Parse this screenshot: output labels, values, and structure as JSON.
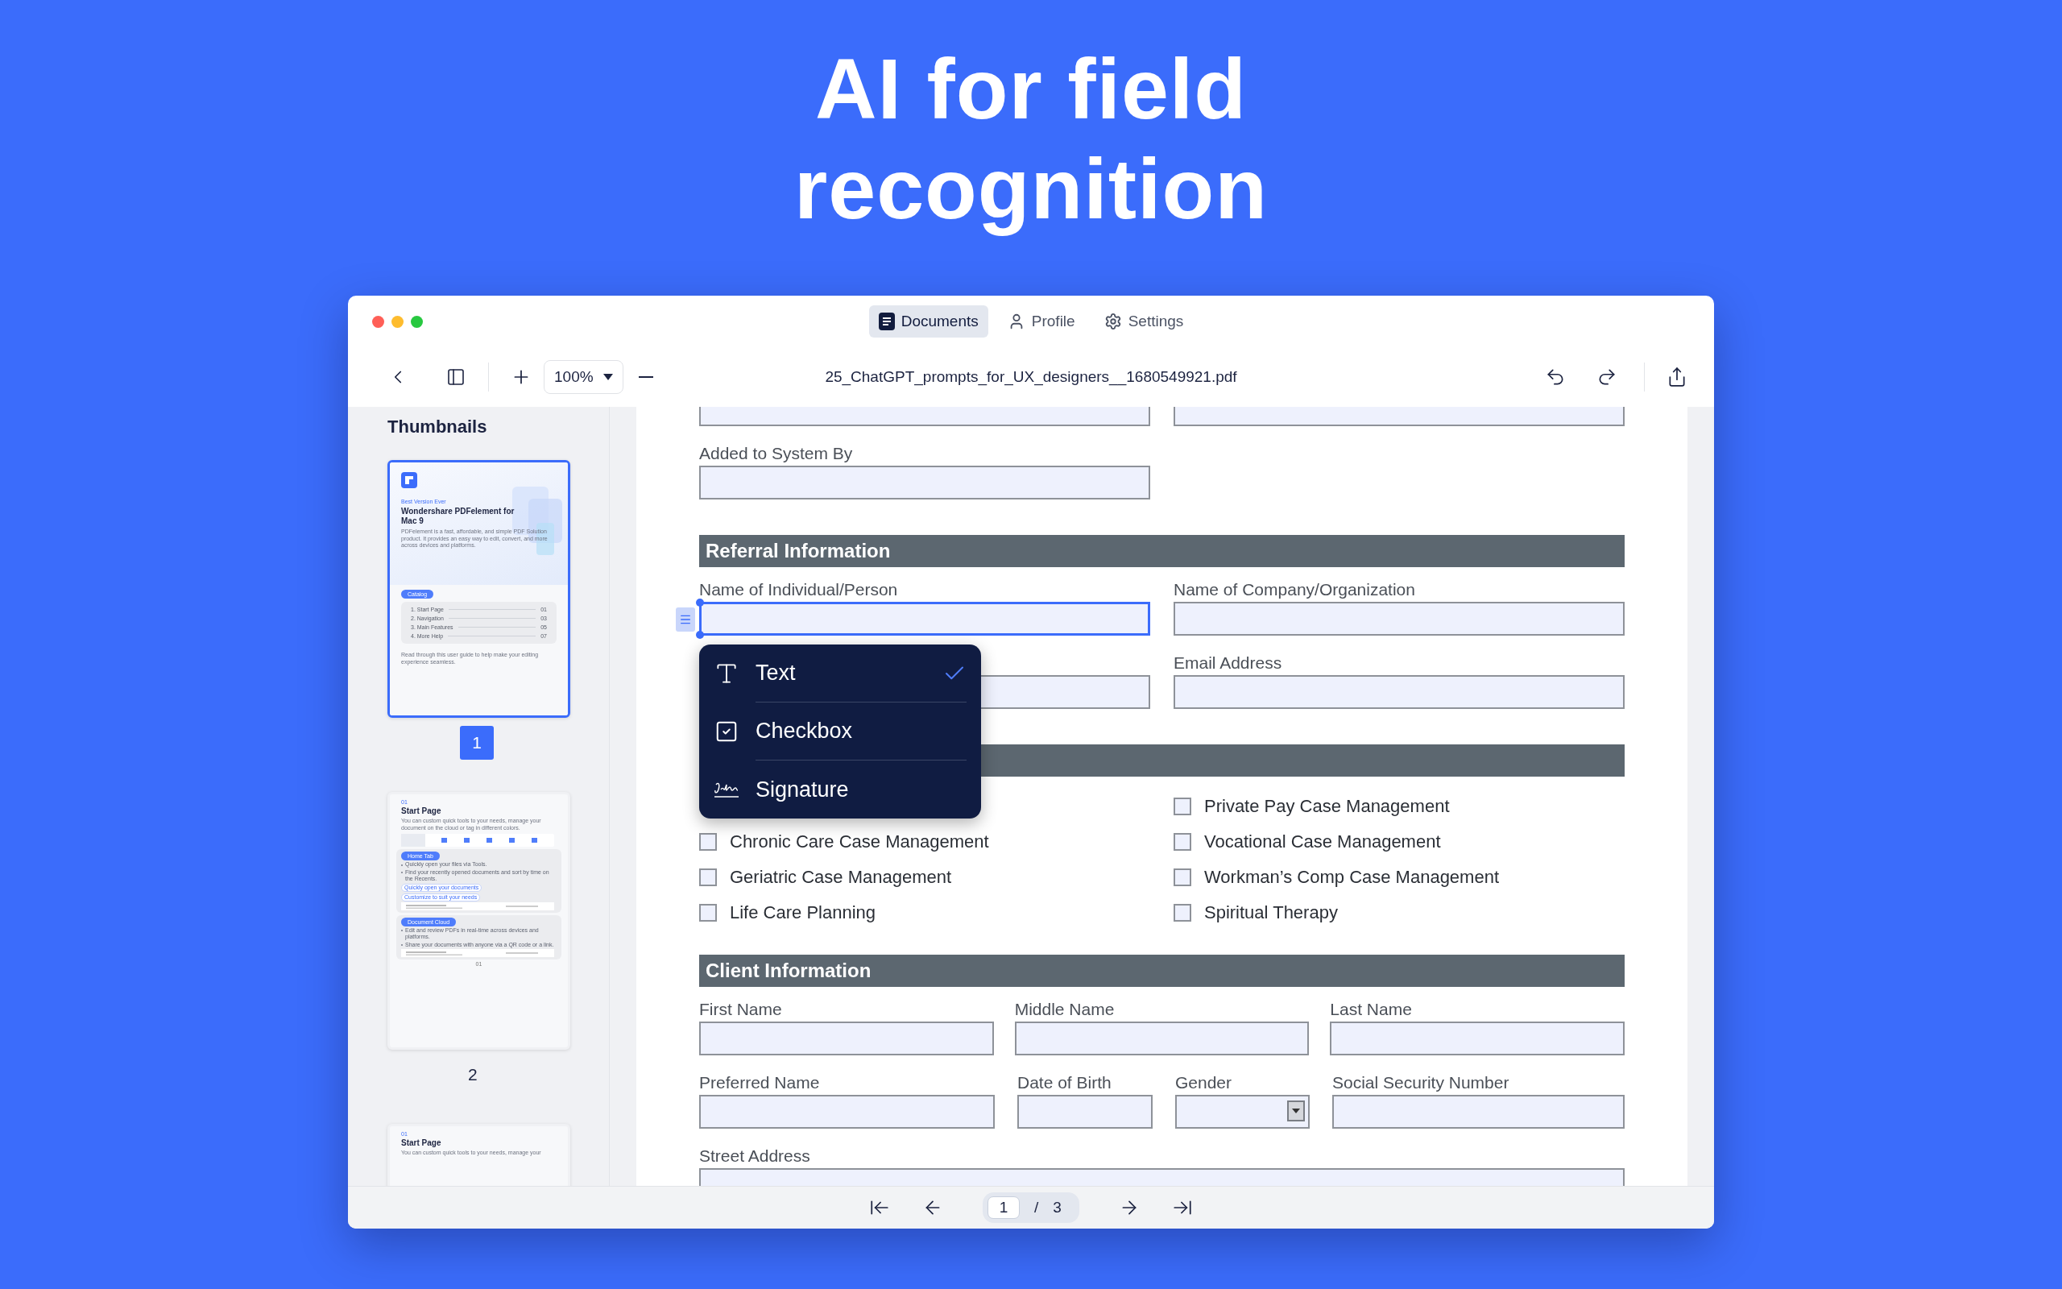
{
  "headline": "AI for field recognition",
  "tabs": [
    {
      "label": "Documents",
      "selected": true
    },
    {
      "label": "Profile",
      "selected": false
    },
    {
      "label": "Settings",
      "selected": false
    }
  ],
  "toolbar": {
    "zoom": "100%",
    "filename": "25_ChatGPT_prompts_for_UX_designers__1680549921.pdf"
  },
  "sidebar": {
    "title": "Thumbnails",
    "pages": [
      {
        "kind": "cover",
        "label": "1",
        "selected": true,
        "eyebrow": "Best Version Ever",
        "title": "Wondershare PDFelement for Mac 9",
        "text": "PDFelement is a fast, affordable, and simple PDF Solution product. It provides an easy way to edit, convert, and more across devices and platforms.",
        "pill": "Catalog",
        "toc": [
          {
            "title": "1. Start Page",
            "page": "01"
          },
          {
            "title": "2. Navigation",
            "page": "03"
          },
          {
            "title": "3. Main Features",
            "page": "05"
          },
          {
            "title": "4. More Help",
            "page": "07"
          }
        ],
        "footer": "Read through this user guide to help make your editing experience seamless."
      },
      {
        "kind": "section",
        "label": "2",
        "selected": false,
        "number": "01",
        "title": "Start Page",
        "text": "You can custom quick tools to your needs, manage your document on the cloud or tag in different colors.",
        "blocks": [
          {
            "pill": "Home Tab",
            "bullets": [
              "Quickly open your files via Tools.",
              "Find your recently opened documents and sort by time on the Recents."
            ],
            "chips": [
              "Quickly open your documents",
              "Customize to suit your needs"
            ]
          },
          {
            "pill": "Document Cloud",
            "bullets": [
              "Edit and review PDFs in real-time across devices and platforms.",
              "Share your documents with anyone via a QR code or a link."
            ]
          }
        ],
        "footer": "01"
      },
      {
        "kind": "section",
        "selected": false,
        "number": "01",
        "title": "Start Page",
        "text": "You can custom quick tools to your needs, manage your"
      }
    ]
  },
  "form": [
    {
      "kind": "fields",
      "fields": [
        {
          "selected": false
        },
        {
          "selected": false
        }
      ]
    },
    {
      "kind": "fields",
      "fields": [
        {
          "label": "Added to System By",
          "selected": false
        }
      ]
    },
    {
      "kind": "header",
      "title": "Referral Information"
    },
    {
      "kind": "fields",
      "fields": [
        {
          "label": "Name of Individual/Person",
          "selected": true
        },
        {
          "label": "Name of Company/Organization",
          "selected": false
        }
      ]
    },
    {
      "kind": "fields",
      "fields": [
        {
          "selected": false
        },
        {
          "label": "Email Address",
          "selected": false
        }
      ]
    },
    {
      "kind": "header"
    },
    {
      "kind": "checks",
      "columns": [
        [
          {
            "label": "Chronic Care Case Management",
            "checked": false
          },
          {
            "label": "Geriatric Case Management",
            "checked": false
          },
          {
            "label": "Life Care Planning",
            "checked": false
          }
        ],
        [
          {
            "label": "Private Pay Case Management",
            "checked": false
          },
          {
            "label": "Vocational Case Management",
            "checked": false
          },
          {
            "label": "Workman’s Comp Case Management",
            "checked": false
          },
          {
            "label": "Spiritual Therapy",
            "checked": false
          }
        ]
      ]
    },
    {
      "kind": "header",
      "title": "Client Information"
    },
    {
      "kind": "fields",
      "fields": [
        {
          "label": "First Name",
          "selected": false
        },
        {
          "label": "Middle Name",
          "selected": false
        },
        {
          "label": "Last Name",
          "selected": false
        }
      ]
    },
    {
      "kind": "fields",
      "fields": [
        {
          "label": "Preferred Name",
          "selected": false
        },
        {
          "label": "Date of Birth",
          "selected": false
        },
        {
          "label": "Gender",
          "selected": false,
          "dropdown": true
        },
        {
          "label": "Social Security Number",
          "selected": false
        }
      ]
    },
    {
      "kind": "fields",
      "fields": [
        {
          "label": "Street Address",
          "selected": false,
          "wide": true
        }
      ]
    }
  ],
  "field_menu": {
    "items": [
      {
        "label": "Text",
        "selected": true
      },
      {
        "label": "Checkbox",
        "selected": false
      },
      {
        "label": "Signature",
        "selected": false
      }
    ]
  },
  "pager": {
    "current": "1",
    "separator": "/",
    "total": "3"
  }
}
